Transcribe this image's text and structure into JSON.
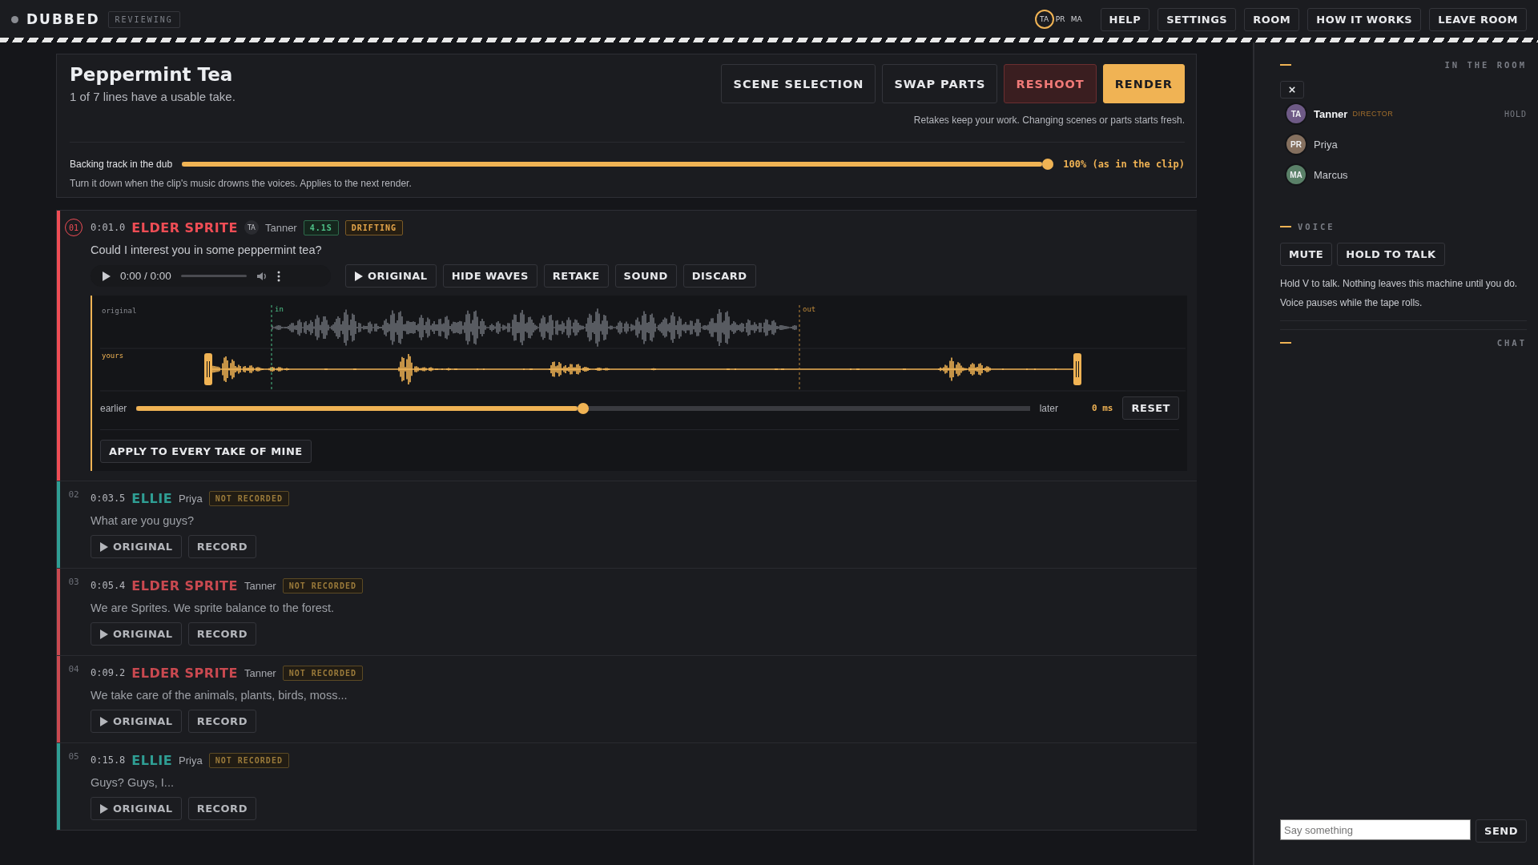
{
  "app": {
    "name": "DUBBED",
    "status": "REVIEWING"
  },
  "presence": [
    {
      "initials": "TA",
      "speaking": true
    },
    {
      "initials": "PR",
      "speaking": false
    },
    {
      "initials": "MA",
      "speaking": false
    }
  ],
  "nav": [
    "HELP",
    "SETTINGS",
    "ROOM",
    "HOW IT WORKS",
    "LEAVE ROOM"
  ],
  "scene": {
    "title": "Peppermint Tea",
    "subtitle": "1 of 7 lines have a usable take.",
    "actions": [
      {
        "label": "SCENE SELECTION",
        "kind": "plain"
      },
      {
        "label": "SWAP PARTS",
        "kind": "plain"
      },
      {
        "label": "RESHOOT",
        "kind": "danger"
      },
      {
        "label": "RENDER",
        "kind": "primary"
      }
    ],
    "note": "Retakes keep your work. Changing scenes or parts starts fresh.",
    "backing": {
      "label": "Backing track in the dub",
      "level": 1,
      "reading": "100% (as in the clip)",
      "hint": "Turn it down when the clip's music drowns the voices. Applies to the next render."
    }
  },
  "lines": [
    {
      "number": "01",
      "current": true,
      "expanded": true,
      "color": "#ef4d55",
      "time": "0:01.0",
      "character": "ELDER SPRITE",
      "actor_initials": "TA",
      "actor": "Tanner",
      "badges": [
        {
          "text": "4.1S",
          "kind": "ok"
        },
        {
          "text": "DRIFTING",
          "kind": "warn"
        }
      ],
      "text": "Could I interest you in some peppermint tea?",
      "player": {
        "time": "0:00 / 0:00"
      },
      "actions": [
        {
          "label": "ORIGINAL",
          "kind": "play"
        },
        {
          "label": "HIDE WAVES",
          "kind": "plain"
        },
        {
          "label": "RETAKE",
          "kind": "plain"
        },
        {
          "label": "SOUND",
          "kind": "plain"
        },
        {
          "label": "DISCARD",
          "kind": "plain"
        }
      ],
      "waves": {
        "original_label": "original",
        "in_label": "in",
        "out_label": "out",
        "yours_label": "yours"
      },
      "offset": {
        "earlier": "earlier",
        "level": 0.5,
        "later": "later",
        "reading": "0 ms",
        "reset": "RESET",
        "apply": "APPLY TO EVERY TAKE OF MINE"
      }
    },
    {
      "number": "02",
      "current": false,
      "expanded": false,
      "color": "#2f9e94",
      "time": "0:03.5",
      "character": "ELLIE",
      "actor": "Priya",
      "badges": [
        {
          "text": "NOT RECORDED",
          "kind": "muted"
        }
      ],
      "text": "What are you guys?",
      "actions": [
        {
          "label": "ORIGINAL",
          "kind": "play"
        },
        {
          "label": "RECORD",
          "kind": "plain"
        }
      ]
    },
    {
      "number": "03",
      "current": false,
      "expanded": false,
      "color": "#c94950",
      "time": "0:05.4",
      "character": "ELDER SPRITE",
      "actor": "Tanner",
      "badges": [
        {
          "text": "NOT RECORDED",
          "kind": "muted"
        }
      ],
      "text": "We are Sprites. We sprite balance to the forest.",
      "actions": [
        {
          "label": "ORIGINAL",
          "kind": "play"
        },
        {
          "label": "RECORD",
          "kind": "plain"
        }
      ]
    },
    {
      "number": "04",
      "current": false,
      "expanded": false,
      "color": "#c94950",
      "time": "0:09.2",
      "character": "ELDER SPRITE",
      "actor": "Tanner",
      "badges": [
        {
          "text": "NOT RECORDED",
          "kind": "muted"
        }
      ],
      "text": "We take care of the animals, plants, birds, moss...",
      "actions": [
        {
          "label": "ORIGINAL",
          "kind": "play"
        },
        {
          "label": "RECORD",
          "kind": "plain"
        }
      ]
    },
    {
      "number": "05",
      "current": false,
      "expanded": false,
      "color": "#2f9e94",
      "time": "0:15.8",
      "character": "ELLIE",
      "actor": "Priya",
      "badges": [
        {
          "text": "NOT RECORDED",
          "kind": "muted"
        }
      ],
      "text": "Guys? Guys, I...",
      "actions": [
        {
          "label": "ORIGINAL",
          "kind": "play"
        },
        {
          "label": "RECORD",
          "kind": "plain"
        }
      ]
    }
  ],
  "sidebar": {
    "sections": [
      {
        "kind": "room",
        "heading": "IN THE ROOM",
        "members": [
          {
            "initials": "TA",
            "name": "Tanner",
            "role": "DIRECTOR",
            "status": "HOLD",
            "is_self": true,
            "color": "#6e5a86"
          },
          {
            "initials": "PR",
            "name": "Priya",
            "is_self": false,
            "color": "#85705f"
          },
          {
            "initials": "MA",
            "name": "Marcus",
            "is_self": false,
            "color": "#5a8068"
          }
        ]
      },
      {
        "kind": "voice",
        "heading": "VOICE",
        "buttons": [
          "MUTE",
          "HOLD TO TALK"
        ],
        "hints": [
          "Hold V to talk. Nothing leaves this machine until you do.",
          "Voice pauses while the tape rolls."
        ]
      },
      {
        "kind": "chat",
        "heading": "CHAT",
        "placeholder": "Say something",
        "send": "SEND"
      }
    ]
  }
}
